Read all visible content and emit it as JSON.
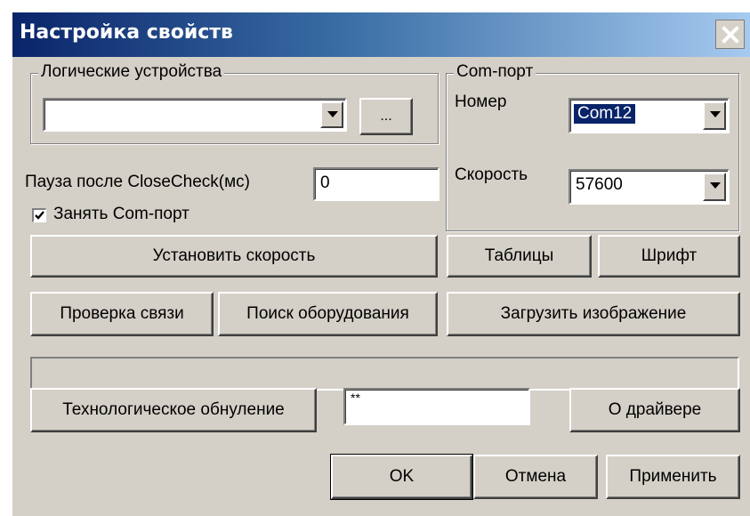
{
  "window": {
    "title": "Настройка свойств",
    "close_icon": "close-icon"
  },
  "logical_devices": {
    "legend": "Логические устройства",
    "select_value": "",
    "browse_label": "..."
  },
  "com_port": {
    "legend": "Com-порт",
    "number_label": "Номер",
    "number_value": "Com12",
    "speed_label": "Скорость",
    "speed_value": "57600"
  },
  "pause": {
    "label": "Пауза после CloseCheck(мс)",
    "value": "0"
  },
  "occupy_port": {
    "label": "Занять Com-порт",
    "checked": true
  },
  "buttons": {
    "set_speed": "Установить скорость",
    "tables": "Таблицы",
    "font": "Шрифт",
    "check_connection": "Проверка связи",
    "search_equipment": "Поиск оборудования",
    "load_image": "Загрузить изображение",
    "tech_reset": "Технологическое обнуление",
    "about_driver": "О драйвере",
    "ok": "OK",
    "cancel": "Отмена",
    "apply": "Применить"
  },
  "password_field": {
    "value": "**"
  },
  "status_bar": {
    "text": ""
  },
  "colors": {
    "face": "#d4d0c8",
    "title_start": "#0a246a",
    "title_end": "#a6caf0",
    "selection": "#0a246a"
  }
}
